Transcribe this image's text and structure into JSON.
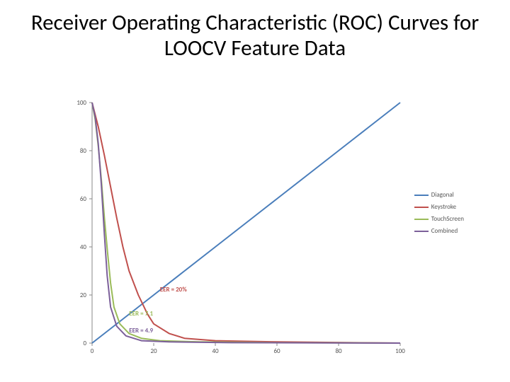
{
  "title": "Receiver Operating Characteristic (ROC) Curves for LOOCV Feature Data",
  "chart_data": {
    "type": "line",
    "xlabel": "",
    "ylabel": "",
    "xlim": [
      0,
      100
    ],
    "ylim": [
      0,
      100
    ],
    "x_ticks": [
      0,
      20,
      40,
      60,
      80,
      100
    ],
    "y_ticks": [
      0,
      20,
      40,
      60,
      80,
      100
    ],
    "legend_position": "right",
    "series": [
      {
        "name": "Diagonal",
        "color": "#4a7ebb",
        "x": [
          0,
          10,
          20,
          30,
          40,
          50,
          60,
          70,
          80,
          90,
          100
        ],
        "values": [
          0,
          10,
          20,
          30,
          40,
          50,
          60,
          70,
          80,
          90,
          100
        ]
      },
      {
        "name": "Keystroke",
        "color": "#c0504d",
        "x": [
          0,
          2,
          4,
          6,
          8,
          10,
          12,
          15,
          18,
          20,
          25,
          30,
          40,
          60,
          100
        ],
        "values": [
          100,
          90,
          78,
          65,
          52,
          40,
          30,
          20,
          12,
          8,
          4,
          2,
          1,
          0.5,
          0
        ]
      },
      {
        "name": "TouchScreen",
        "color": "#9abb59",
        "x": [
          0,
          1,
          2,
          3,
          4,
          5,
          6,
          7.1,
          9,
          12,
          16,
          22,
          35,
          60,
          100
        ],
        "values": [
          100,
          93,
          82,
          68,
          52,
          38,
          25,
          15,
          8,
          4,
          2,
          1,
          0.5,
          0.2,
          0
        ]
      },
      {
        "name": "Combined",
        "color": "#7c609a",
        "x": [
          0,
          1,
          2,
          3,
          4,
          4.9,
          6,
          8,
          11,
          16,
          25,
          45,
          100
        ],
        "values": [
          100,
          94,
          83,
          66,
          45,
          28,
          15,
          7,
          3,
          1,
          0.5,
          0.2,
          0
        ]
      }
    ],
    "annotations": [
      {
        "text": "EER = 20%",
        "x": 22,
        "y": 22,
        "color": "#c0504d"
      },
      {
        "text": "EER = 7.1",
        "x": 12,
        "y": 12,
        "color": "#9abb59"
      },
      {
        "text": "EER = 4.9",
        "x": 12,
        "y": 5,
        "color": "#7c609a"
      }
    ]
  },
  "legend": {
    "items": [
      {
        "label": "Diagonal",
        "color": "#4a7ebb"
      },
      {
        "label": "Keystroke",
        "color": "#c0504d"
      },
      {
        "label": "TouchScreen",
        "color": "#9abb59"
      },
      {
        "label": "Combined",
        "color": "#7c609a"
      }
    ]
  }
}
